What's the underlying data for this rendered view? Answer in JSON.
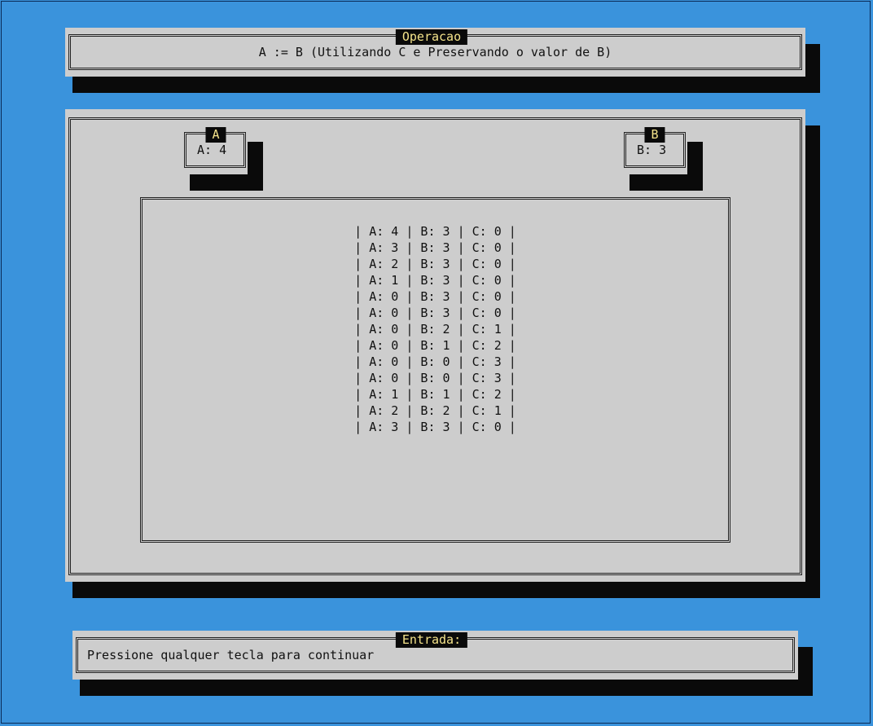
{
  "operation": {
    "title": "Operacao",
    "text": "A := B (Utilizando C e Preservando o valor de B)"
  },
  "register_a": {
    "title": "A",
    "value": "A: 4"
  },
  "register_b": {
    "title": "B",
    "value": "B: 3"
  },
  "trace": {
    "rows": [
      "| A: 4 | B: 3 | C: 0 |",
      "| A: 3 | B: 3 | C: 0 |",
      "| A: 2 | B: 3 | C: 0 |",
      "| A: 1 | B: 3 | C: 0 |",
      "| A: 0 | B: 3 | C: 0 |",
      "| A: 0 | B: 3 | C: 0 |",
      "| A: 0 | B: 2 | C: 1 |",
      "| A: 0 | B: 1 | C: 2 |",
      "| A: 0 | B: 0 | C: 3 |",
      "| A: 0 | B: 0 | C: 3 |",
      "| A: 1 | B: 1 | C: 2 |",
      "| A: 2 | B: 2 | C: 1 |",
      "| A: 3 | B: 3 | C: 0 |"
    ]
  },
  "input": {
    "title": "Entrada:",
    "prompt": "Pressione qualquer tecla para continuar"
  }
}
